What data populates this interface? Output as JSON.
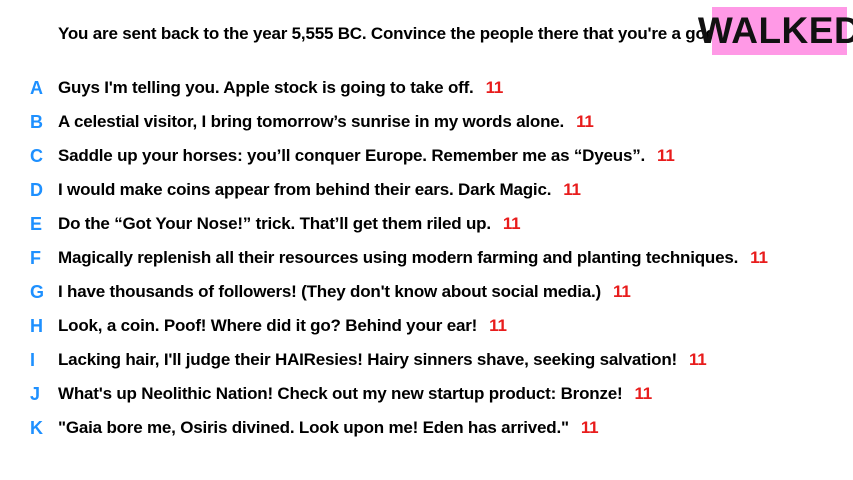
{
  "prompt": "You are sent back to the year 5,555 BC. Convince the people there that you're a god.",
  "status": {
    "label": "WALKED",
    "background": "#ff99e6"
  },
  "colors": {
    "letter": "#1e90ff",
    "score": "#e81c1c"
  },
  "answers": [
    {
      "letter": "A",
      "text": "Guys I'm telling you. Apple stock is going to take off.",
      "score": "11"
    },
    {
      "letter": "B",
      "text": "A celestial visitor, I bring tomorrow’s sunrise in my words alone.",
      "score": "11"
    },
    {
      "letter": "C",
      "text": "Saddle up your horses: you’ll conquer Europe. Remember me as “Dyeus”.",
      "score": "11"
    },
    {
      "letter": "D",
      "text": "I would make coins appear from behind their ears. Dark Magic.",
      "score": "11"
    },
    {
      "letter": "E",
      "text": "Do the “Got Your Nose!” trick. That’ll get them riled up.",
      "score": "11"
    },
    {
      "letter": "F",
      "text": "Magically replenish all their resources using modern farming and planting techniques.",
      "score": "11"
    },
    {
      "letter": "G",
      "text": "I have thousands of followers! (They don't know about social media.)",
      "score": "11"
    },
    {
      "letter": "H",
      "text": "Look, a coin. Poof! Where did it go? Behind your ear!",
      "score": "11"
    },
    {
      "letter": "I",
      "text": "Lacking hair, I'll judge their HAIResies!  Hairy sinners shave, seeking salvation!",
      "score": "11"
    },
    {
      "letter": "J",
      "text": "What's up Neolithic Nation! Check out my new startup product: Bronze!",
      "score": "11"
    },
    {
      "letter": "K",
      "text": "\"Gaia bore me, Osiris divined. Look upon me! Eden has arrived.\"",
      "score": "11"
    }
  ]
}
